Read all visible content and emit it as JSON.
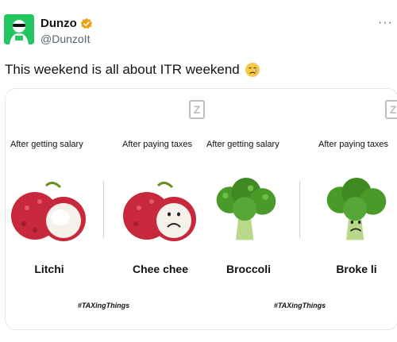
{
  "tweet": {
    "display_name": "Dunzo",
    "handle": "@DunzoIt",
    "text": "This weekend is all about ITR weekend",
    "more_label": "···"
  },
  "card": {
    "panels": [
      {
        "left_caption": "After getting salary",
        "right_caption": "After paying taxes",
        "left_label": "Litchi",
        "right_label": "Chee chee",
        "hashtag": "#TAXingThings"
      },
      {
        "left_caption": "After getting salary",
        "right_caption": "After paying taxes",
        "left_label": "Broccoli",
        "right_label": "Broke li",
        "hashtag": "#TAXingThings"
      }
    ],
    "watermark": "Z"
  },
  "colors": {
    "avatar_bg": "#22c55e",
    "verified_badge": "#e8a317",
    "litchi_skin": "#c7283c",
    "broccoli": "#4a9a2a"
  }
}
